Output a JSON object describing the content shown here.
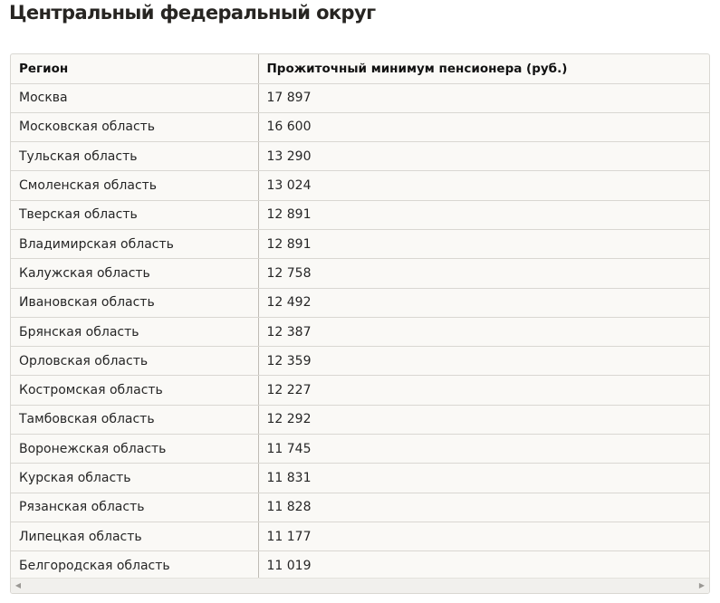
{
  "title": "Центральный федеральный округ",
  "table": {
    "headers": [
      "Регион",
      "Прожиточный минимум пенсионера (руб.)"
    ],
    "rows": [
      [
        "Москва",
        "17 897"
      ],
      [
        "Московская область",
        "16 600"
      ],
      [
        "Тульская область",
        "13 290"
      ],
      [
        "Смоленская область",
        "13 024"
      ],
      [
        "Тверская область",
        "12 891"
      ],
      [
        "Владимирская область",
        "12 891"
      ],
      [
        "Калужская область",
        "12 758"
      ],
      [
        "Ивановская область",
        "12 492"
      ],
      [
        "Брянская область",
        "12 387"
      ],
      [
        "Орловская область",
        "12 359"
      ],
      [
        "Костромская область",
        "12 227"
      ],
      [
        "Тамбовская область",
        "12 292"
      ],
      [
        "Воронежская область",
        "11 745"
      ],
      [
        "Курская область",
        "11 831"
      ],
      [
        "Рязанская область",
        "11 828"
      ],
      [
        "Липецкая область",
        "11 177"
      ],
      [
        "Белгородская область",
        "11 019"
      ]
    ]
  },
  "scrollbar": {
    "left_icon": "chevron-left-icon",
    "right_icon": "chevron-right-icon"
  }
}
